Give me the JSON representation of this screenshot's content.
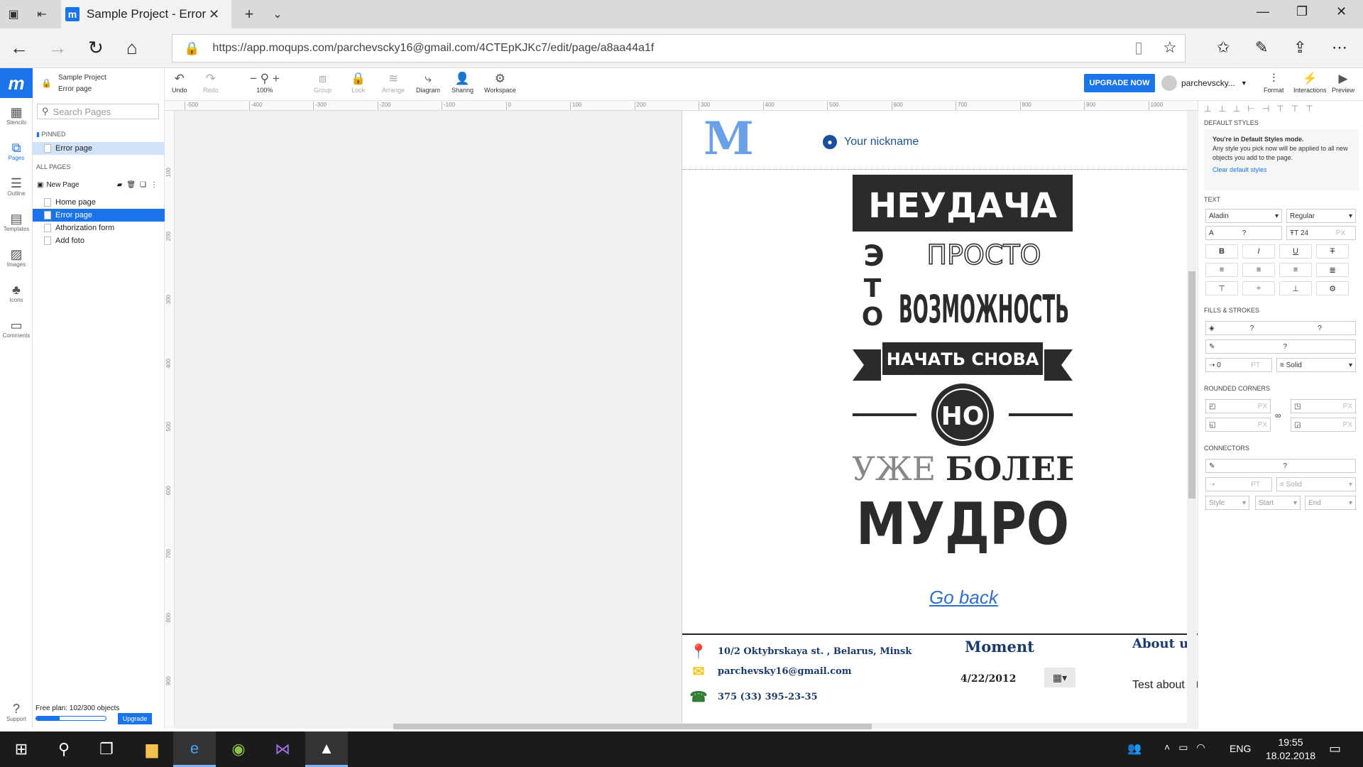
{
  "browser": {
    "tab_title": "Sample Project - Error p",
    "url": "https://app.moqups.com/parchevscky16@gmail.com/4CTEpKJKc7/edit/page/a8aa44a1f"
  },
  "app": {
    "project_name": "Sample Project",
    "page_name": "Error page",
    "logo": "m",
    "upgrade_now": "UPGRADE NOW",
    "user": "parchevscky...",
    "format": "Format",
    "interactions": "Interactions",
    "preview": "Preview"
  },
  "leftbar": [
    {
      "label": "Stencils",
      "icon": "stencils-icon"
    },
    {
      "label": "Pages",
      "icon": "pages-icon"
    },
    {
      "label": "Outline",
      "icon": "outline-icon"
    },
    {
      "label": "Templates",
      "icon": "templates-icon"
    },
    {
      "label": "Images",
      "icon": "images-icon"
    },
    {
      "label": "Icons",
      "icon": "icons-icon"
    },
    {
      "label": "Comments",
      "icon": "comments-icon"
    },
    {
      "label": "Support",
      "icon": "support-icon"
    }
  ],
  "pages": {
    "search_placeholder": "Search Pages",
    "pinned_label": "PINNED",
    "pinned_item": "Error page",
    "all_label": "ALL PAGES",
    "new_page": "New Page",
    "items": [
      "Home page",
      "Error page",
      "Athorization form",
      "Add foto"
    ]
  },
  "plan": {
    "text": "Free plan: 102/300 objects",
    "used": 102,
    "total": 300,
    "upgrade": "Upgrade"
  },
  "toolbar": {
    "undo": "Undo",
    "redo": "Redo",
    "zoom": "100%",
    "group": "Group",
    "lock": "Lock",
    "arrange": "Arrange",
    "diagram": "Diagram",
    "sharing": "Sharing",
    "workspace": "Workspace"
  },
  "ruler": {
    "top": [
      "-500",
      "-400",
      "-300",
      "-200",
      "-100",
      "0",
      "100",
      "200",
      "300",
      "400",
      "500",
      "600",
      "700",
      "800",
      "900",
      "1000"
    ],
    "left": [
      "100",
      "200",
      "300",
      "400",
      "500",
      "600",
      "700",
      "800",
      "900"
    ]
  },
  "canvas": {
    "logo_letter": "M",
    "nickname": "Your nickname",
    "poster": {
      "line1": "НЕУДАЧА",
      "line2a": "Э",
      "line2b": "ПРОСТО",
      "line3a": "Т",
      "line3b": "О",
      "line3c": "ВОЗМОЖНОСТЬ",
      "ribbon": "НАЧАТЬ СНОВА",
      "circle": "НО",
      "line5a": "УЖЕ",
      "line5b": "БОЛЕЕ",
      "line6": "МУДРО"
    },
    "go_back": "Go back",
    "address": "10/2 Oktybrskaya st. , Belarus, Minsk",
    "email": "parchevsky16@gmail.com",
    "phone": "375 (33) 395-23-35",
    "moment": "Moment",
    "date": "4/22/2012",
    "about": "About us",
    "about_text": "Test about site"
  },
  "rpanel": {
    "default_styles": "DEFAULT STYLES",
    "info_title": "You're in Default Styles mode.",
    "info_body": "Any style you pick now will be applied to all new objects you add to the page.",
    "clear": "Clear default styles",
    "text": "TEXT",
    "font": "Aladin",
    "weight": "Regular",
    "size": "24",
    "size_unit": "PX",
    "fills": "FILLS & STROKES",
    "stroke_width": "0",
    "stroke_unit": "PT",
    "stroke_style": "Solid",
    "corners": "ROUNDED CORNERS",
    "px": "PX",
    "connectors": "CONNECTORS",
    "conn_style": "Solid",
    "style": "Style",
    "start": "Start",
    "end": "End",
    "unknown": "?"
  },
  "taskbar": {
    "lang": "ENG",
    "time": "19:55",
    "date": "18.02.2018"
  },
  "colors": {
    "brand": "#1a73e8",
    "nick": "#1a4f9c",
    "goback": "#2e6fc9"
  }
}
